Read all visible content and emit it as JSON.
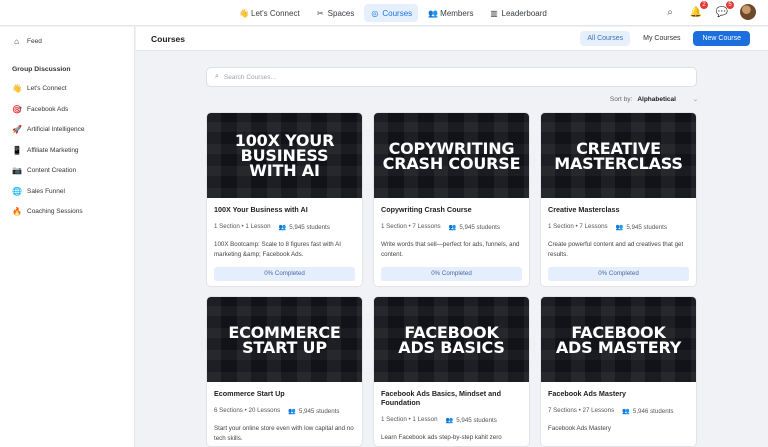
{
  "topnav": {
    "tabs": [
      {
        "label": "Let's Connect",
        "icon": "waving-hand-icon",
        "glyph": "👋"
      },
      {
        "label": "Spaces",
        "icon": "spaces-icon",
        "glyph": "✂"
      },
      {
        "label": "Courses",
        "icon": "courses-icon",
        "glyph": "◎"
      },
      {
        "label": "Members",
        "icon": "members-icon",
        "glyph": "👥"
      },
      {
        "label": "Leaderboard",
        "icon": "leaderboard-icon",
        "glyph": "▥"
      }
    ],
    "active_tab": "Courses",
    "notification_count": "2",
    "message_count": "5"
  },
  "sidebar": {
    "feed_label": "Feed",
    "group_heading": "Group Discussion",
    "items": [
      {
        "label": "Let's Connect",
        "icon": "waving-hand-icon",
        "glyph": "👋"
      },
      {
        "label": "Facebook Ads",
        "icon": "target-icon",
        "glyph": "🎯"
      },
      {
        "label": "Artificial Intelligence",
        "icon": "rocket-icon",
        "glyph": "🚀"
      },
      {
        "label": "Affiliate Marketing",
        "icon": "phone-icon",
        "glyph": "📱"
      },
      {
        "label": "Content Creation",
        "icon": "camera-icon",
        "glyph": "📷"
      },
      {
        "label": "Sales Funnel",
        "icon": "globe-icon",
        "glyph": "🌐"
      },
      {
        "label": "Coaching Sessions",
        "icon": "fire-icon",
        "glyph": "🔥"
      }
    ]
  },
  "courses_header": {
    "title": "Courses",
    "all_courses": "All Courses",
    "my_courses": "My Courses",
    "new_course": "New Course"
  },
  "search": {
    "placeholder": "Search Courses..."
  },
  "sort": {
    "label": "Sort by:",
    "value": "Alphabetical"
  },
  "courses": [
    {
      "thumb": "100X YOUR\nBUSINESS\nWITH AI",
      "title": "100X Your Business with AI",
      "sections": "1 Section",
      "lessons": "1 Lesson",
      "students": "5,945 students",
      "description": "100X Bootcamp: Scale to 8 figures fast with AI marketing &amp; Facebook Ads.",
      "progress_label": "0% Completed",
      "progress": 0
    },
    {
      "thumb": "COPYWRITING\nCRASH COURSE",
      "title": "Copywriting Crash Course",
      "sections": "1 Section",
      "lessons": "7 Lessons",
      "students": "5,945 students",
      "description": "Write words that sell—perfect for ads, funnels, and content.",
      "progress_label": "0% Completed",
      "progress": 0
    },
    {
      "thumb": "CREATIVE\nMASTERCLASS",
      "title": "Creative Masterclass",
      "sections": "1 Section",
      "lessons": "7 Lessons",
      "students": "5,945 students",
      "description": "Create powerful content and ad creatives that get results.",
      "progress_label": "0% Completed",
      "progress": 0
    },
    {
      "thumb": "ECOMMERCE\nSTART UP",
      "title": "Ecommerce Start Up",
      "sections": "6 Sections",
      "lessons": "20 Lessons",
      "students": "5,945 students",
      "description": "Start your online store even with low capital and no tech skills.",
      "progress_label": "",
      "progress": 0
    },
    {
      "thumb": "FACEBOOK\nADS BASICS",
      "title": "Facebook Ads Basics, Mindset and Foundation",
      "sections": "1 Section",
      "lessons": "1 Lesson",
      "students": "5,945 students",
      "description": "Learn Facebook ads step-by-step kahit zero",
      "progress_label": "",
      "progress": 0
    },
    {
      "thumb": "FACEBOOK\nADS MASTERY",
      "title": "Facebook Ads Mastery",
      "sections": "7 Sections",
      "lessons": "27 Lessons",
      "students": "5,946 students",
      "description": "Facebook Ads Mastery",
      "progress_label": "",
      "progress": 0
    }
  ]
}
